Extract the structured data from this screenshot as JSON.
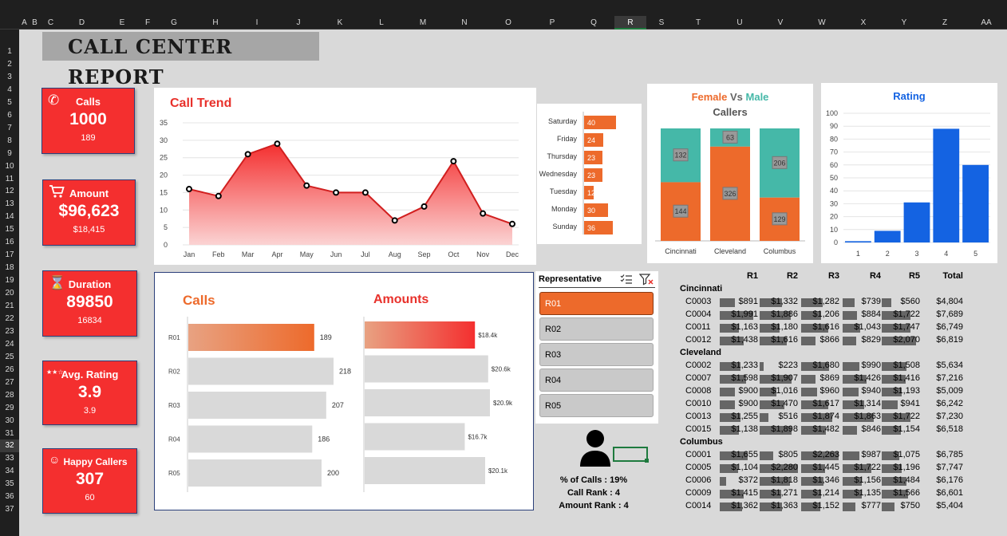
{
  "columns": [
    "A",
    "B",
    "C",
    "D",
    "E",
    "F",
    "G",
    "H",
    "I",
    "J",
    "K",
    "L",
    "M",
    "N",
    "O",
    "P",
    "Q",
    "R",
    "S",
    "T",
    "U",
    "V",
    "W",
    "X",
    "Y",
    "Z",
    "AA"
  ],
  "selected_column": "R",
  "rows": [
    "1",
    "2",
    "3",
    "4",
    "5",
    "6",
    "7",
    "8",
    "9",
    "10",
    "11",
    "12",
    "13",
    "14",
    "15",
    "16",
    "17",
    "18",
    "19",
    "20",
    "21",
    "22",
    "23",
    "24",
    "25",
    "26",
    "27",
    "28",
    "29",
    "30",
    "31",
    "32",
    "33",
    "34",
    "35",
    "36",
    "37"
  ],
  "selected_row": "32",
  "title": "CALL CENTER REPORT",
  "kpis": [
    {
      "label": "Calls",
      "value": "1000",
      "sub": "189",
      "icon": "phone-icon"
    },
    {
      "label": "Amount",
      "value": "$96,623",
      "sub": "$18,415",
      "icon": "cart-icon"
    },
    {
      "label": "Duration",
      "value": "89850",
      "sub": "16834",
      "icon": "hourglass-icon"
    },
    {
      "label": "Avg. Rating",
      "value": "3.9",
      "sub": "3.9",
      "icon": "stars-icon"
    },
    {
      "label": "Happy Callers",
      "value": "307",
      "sub": "60",
      "icon": "smiley-icon"
    }
  ],
  "charts": {
    "call_trend": {
      "title": "Call Trend",
      "type": "area",
      "categories": [
        "Jan",
        "Feb",
        "Mar",
        "Apr",
        "May",
        "Jun",
        "Jul",
        "Aug",
        "Sep",
        "Oct",
        "Nov",
        "Dec"
      ],
      "values": [
        16,
        14,
        26,
        29,
        17,
        15,
        15,
        7,
        11,
        24,
        9,
        6
      ],
      "ylim": [
        0,
        35
      ],
      "yticks": [
        "0",
        "5",
        "10",
        "15",
        "20",
        "25",
        "30",
        "35"
      ]
    },
    "weekday": {
      "type": "bar",
      "categories": [
        "Saturday",
        "Friday",
        "Thursday",
        "Wednesday",
        "Tuesday",
        "Monday",
        "Sunday"
      ],
      "values": [
        40,
        24,
        23,
        23,
        12,
        30,
        36
      ]
    },
    "gender": {
      "title_female": "Female",
      "title_vs": " Vs ",
      "title_male": "Male",
      "subtitle": "Callers",
      "categories": [
        "Cincinnati",
        "Cleveland",
        "Columbus"
      ],
      "female": [
        144,
        326,
        129
      ],
      "male": [
        132,
        63,
        206
      ]
    },
    "rating": {
      "title": "Rating",
      "categories": [
        "1",
        "2",
        "3",
        "4",
        "5"
      ],
      "values": [
        1,
        9,
        31,
        88,
        60
      ],
      "ylim": [
        0,
        100
      ],
      "yticks": [
        "0",
        "10",
        "20",
        "30",
        "40",
        "50",
        "60",
        "70",
        "80",
        "90",
        "100"
      ]
    },
    "rep_calls": {
      "title": "Calls",
      "categories": [
        "R01",
        "R02",
        "R03",
        "R04",
        "R05"
      ],
      "values": [
        189,
        218,
        207,
        186,
        200
      ]
    },
    "rep_amounts": {
      "title": "Amounts",
      "categories": [
        "R01",
        "R02",
        "R03",
        "R04",
        "R05"
      ],
      "values": [
        18.4,
        20.6,
        20.9,
        16.7,
        20.1
      ],
      "labels": [
        "$18.4k",
        "$20.6k",
        "$20.9k",
        "$16.7k",
        "$20.1k"
      ]
    }
  },
  "slicer": {
    "title": "Representative",
    "items": [
      "R01",
      "R02",
      "R03",
      "R04",
      "R05"
    ],
    "selected": "R01"
  },
  "rep_info": {
    "pct": "% of Calls : 19%",
    "call_rank": "Call Rank : 4",
    "amount_rank": "Amount Rank : 4"
  },
  "pivot": {
    "headers": [
      "R1",
      "R2",
      "R3",
      "R4",
      "R5",
      "Total"
    ],
    "groups": [
      {
        "name": "Cincinnati",
        "rows": [
          {
            "id": "C0003",
            "vals": [
              "$891",
              "$1,332",
              "$1,282",
              "$739",
              "$560"
            ],
            "total": "$4,804"
          },
          {
            "id": "C0004",
            "vals": [
              "$1,991",
              "$1,886",
              "$1,206",
              "$884",
              "$1,722"
            ],
            "total": "$7,689"
          },
          {
            "id": "C0011",
            "vals": [
              "$1,163",
              "$1,180",
              "$1,616",
              "$1,043",
              "$1,747"
            ],
            "total": "$6,749"
          },
          {
            "id": "C0012",
            "vals": [
              "$1,438",
              "$1,616",
              "$866",
              "$829",
              "$2,070"
            ],
            "total": "$6,819"
          }
        ]
      },
      {
        "name": "Cleveland",
        "rows": [
          {
            "id": "C0002",
            "vals": [
              "$1,233",
              "$223",
              "$1,680",
              "$990",
              "$1,508"
            ],
            "total": "$5,634"
          },
          {
            "id": "C0007",
            "vals": [
              "$1,598",
              "$1,907",
              "$869",
              "$1,426",
              "$1,416"
            ],
            "total": "$7,216"
          },
          {
            "id": "C0008",
            "vals": [
              "$900",
              "$1,016",
              "$960",
              "$940",
              "$1,193"
            ],
            "total": "$5,009"
          },
          {
            "id": "C0010",
            "vals": [
              "$900",
              "$1,470",
              "$1,617",
              "$1,314",
              "$941"
            ],
            "total": "$6,242"
          },
          {
            "id": "C0013",
            "vals": [
              "$1,255",
              "$516",
              "$1,874",
              "$1,863",
              "$1,722"
            ],
            "total": "$7,230"
          },
          {
            "id": "C0015",
            "vals": [
              "$1,138",
              "$1,898",
              "$1,482",
              "$846",
              "$1,154"
            ],
            "total": "$6,518"
          }
        ]
      },
      {
        "name": "Columbus",
        "rows": [
          {
            "id": "C0001",
            "vals": [
              "$1,655",
              "$805",
              "$2,263",
              "$987",
              "$1,075"
            ],
            "total": "$6,785"
          },
          {
            "id": "C0005",
            "vals": [
              "$1,104",
              "$2,280",
              "$1,445",
              "$1,722",
              "$1,196"
            ],
            "total": "$7,747"
          },
          {
            "id": "C0006",
            "vals": [
              "$372",
              "$1,818",
              "$1,346",
              "$1,156",
              "$1,484"
            ],
            "total": "$6,176"
          },
          {
            "id": "C0009",
            "vals": [
              "$1,415",
              "$1,271",
              "$1,214",
              "$1,135",
              "$1,566"
            ],
            "total": "$6,601"
          },
          {
            "id": "C0014",
            "vals": [
              "$1,362",
              "$1,363",
              "$1,152",
              "$777",
              "$750"
            ],
            "total": "$5,404"
          }
        ]
      }
    ]
  },
  "colors": {
    "red": "#f42f2f",
    "orange": "#ed6a2b",
    "teal": "#45b8a8",
    "blue": "#1463e2",
    "title_red": "#e8312b"
  }
}
